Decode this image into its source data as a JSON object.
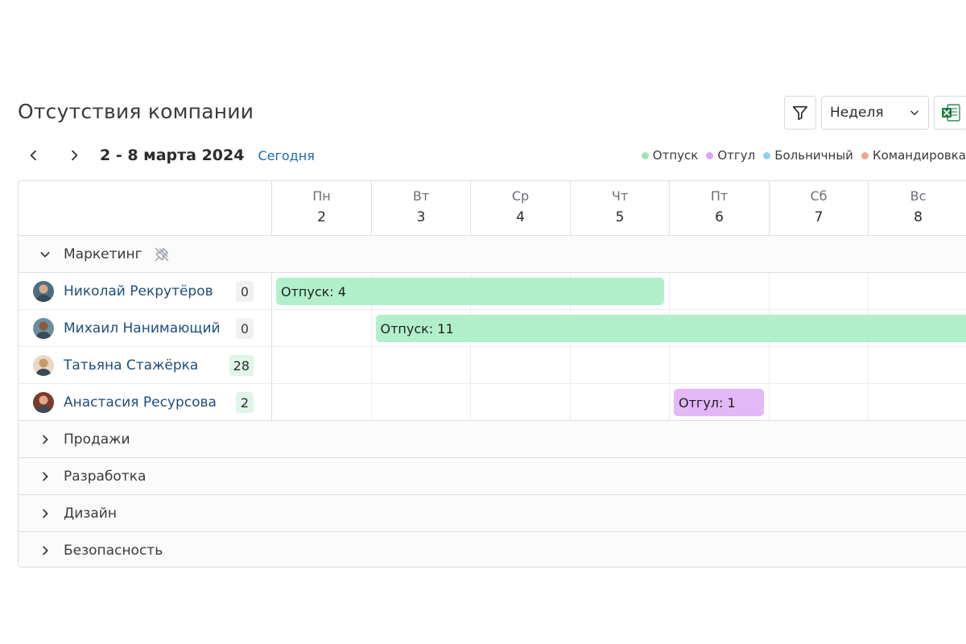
{
  "title": "Отсутствия компании",
  "toolbar": {
    "filter_icon": "filter-icon",
    "view_select": "Неделя",
    "excel_icon": "excel-export-icon"
  },
  "nav": {
    "range": "2 - 8 марта 2024",
    "today": "Сегодня"
  },
  "legend": [
    {
      "label": "Отпуск",
      "color": "#9ce5b9"
    },
    {
      "label": "Отгул",
      "color": "#d7a6f3"
    },
    {
      "label": "Больничный",
      "color": "#8fd0f5"
    },
    {
      "label": "Командировка",
      "color": "#f5a58f"
    }
  ],
  "days": [
    {
      "name": "Пн",
      "num": "2"
    },
    {
      "name": "Вт",
      "num": "3"
    },
    {
      "name": "Ср",
      "num": "4"
    },
    {
      "name": "Чт",
      "num": "5"
    },
    {
      "name": "Пт",
      "num": "6"
    },
    {
      "name": "Сб",
      "num": "7"
    },
    {
      "name": "Вс",
      "num": "8"
    }
  ],
  "groups": [
    {
      "label": "Маркетинг",
      "expanded": true
    },
    {
      "label": "Продажи",
      "expanded": false
    },
    {
      "label": "Разработка",
      "expanded": false
    },
    {
      "label": "Дизайн",
      "expanded": false
    },
    {
      "label": "Безопасность",
      "expanded": false
    }
  ],
  "employees": [
    {
      "name": "Николай Рекрутёров",
      "count": "0"
    },
    {
      "name": "Михаил Нанимающий",
      "count": "0"
    },
    {
      "name": "Татьяна Стажёрка",
      "count": "28"
    },
    {
      "name": "Анастасия Ресурсова",
      "count": "2"
    }
  ],
  "absences": [
    {
      "employee": 0,
      "label": "Отпуск: 4",
      "color": "#b1f0cb"
    },
    {
      "employee": 1,
      "label": "Отпуск: 11",
      "color": "#b1f0cb"
    },
    {
      "employee": 3,
      "label": "Отгул: 1",
      "color": "#e3b8f6"
    }
  ],
  "colors": {
    "link": "#1c4e7c",
    "accent": "#1e6bb0",
    "count_neutral_bg": "#f0f1f3",
    "count_positive_bg": "#dff6e8"
  }
}
